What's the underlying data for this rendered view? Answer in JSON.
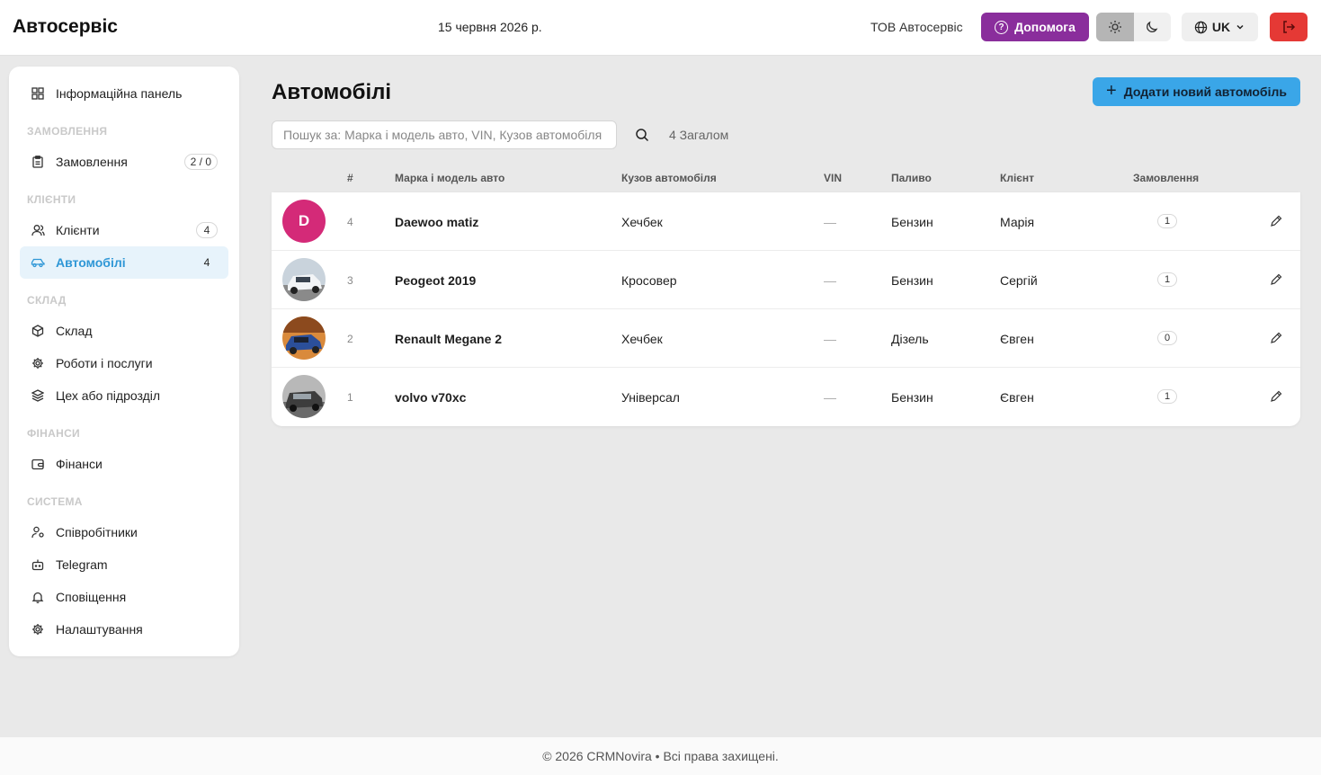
{
  "header": {
    "brand": "Автосервіс",
    "date": "15 червня 2026 р.",
    "company": "ТОВ Автосервіс",
    "help_label": "Допомога",
    "lang_label": "UK"
  },
  "colors": {
    "help": "#8a2e9c",
    "primary": "#3aa6e8",
    "logout": "#e53935",
    "active_nav": "#2f97d6"
  },
  "sidebar": {
    "dashboard": "Інформаційна панель",
    "section_orders": "ЗАМОВЛЕННЯ",
    "orders": "Замовлення",
    "orders_badge": "2 / 0",
    "section_clients": "КЛІЄНТИ",
    "clients": "Клієнти",
    "clients_badge": "4",
    "cars": "Автомобілі",
    "cars_badge": "4",
    "section_warehouse": "СКЛАД",
    "warehouse": "Склад",
    "services": "Роботи і послуги",
    "departments": "Цех або підрозділ",
    "section_finance": "ФІНАНСИ",
    "finance": "Фінанси",
    "section_system": "СИСТЕМА",
    "employees": "Співробітники",
    "telegram": "Telegram",
    "notifications": "Сповіщення",
    "settings": "Налаштування"
  },
  "main": {
    "title": "Автомобілі",
    "add_button": "Додати новий автомобіль",
    "search_placeholder": "Пошук за: Марка і модель авто, VIN, Кузов автомобіля",
    "total": "4 Загалом",
    "columns": [
      "#",
      "Марка і модель авто",
      "Кузов автомобіля",
      "VIN",
      "Паливо",
      "Клієнт",
      "Замовлення"
    ],
    "rows": [
      {
        "avatar": "D",
        "num": "4",
        "name": "Daewoo matiz",
        "body": "Хечбек",
        "vin": "—",
        "fuel": "Бензин",
        "client": "Марія",
        "orders": "1"
      },
      {
        "avatar": "",
        "num": "3",
        "name": "Peogeot 2019",
        "body": "Кросовер",
        "vin": "—",
        "fuel": "Бензин",
        "client": "Сергій",
        "orders": "1"
      },
      {
        "avatar": "",
        "num": "2",
        "name": "Renault Megane 2",
        "body": "Хечбек",
        "vin": "—",
        "fuel": "Дізель",
        "client": "Євген",
        "orders": "0"
      },
      {
        "avatar": "",
        "num": "1",
        "name": "volvo v70xc",
        "body": "Універсал",
        "vin": "—",
        "fuel": "Бензин",
        "client": "Євген",
        "orders": "1"
      }
    ]
  },
  "footer": {
    "text": "© 2026 CRMNovira • Всі права захищені."
  }
}
